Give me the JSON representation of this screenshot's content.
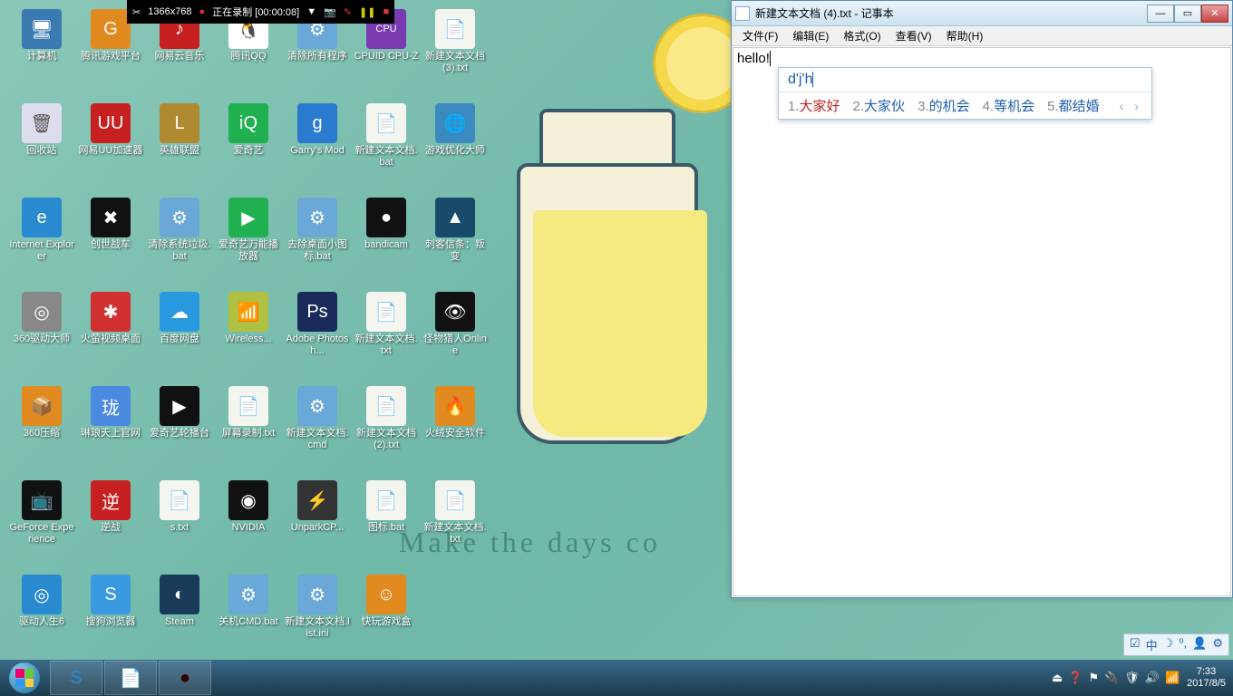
{
  "wallpaper_text": "Make the days co",
  "recording_bar": {
    "crop_icon": "✂",
    "resolution": "1366x768",
    "status": "正在录制 [00:00:08]",
    "dropdown": "▼",
    "cam": "📷",
    "pencil": "✎",
    "pause": "❚❚",
    "stop": "■"
  },
  "desktop_icons": [
    {
      "label": "计算机",
      "bg": "#3a7ab0",
      "glyph": "🖥"
    },
    {
      "label": "腾讯游戏平台",
      "bg": "#e08a20",
      "glyph": "G"
    },
    {
      "label": "网易云音乐",
      "bg": "#c62020",
      "glyph": "♪"
    },
    {
      "label": "腾讯QQ",
      "bg": "#ffffff",
      "glyph": "🐧"
    },
    {
      "label": "清除所有程序",
      "bg": "#6aa8d8",
      "glyph": "⚙"
    },
    {
      "label": "CPUID CPU-Z",
      "bg": "#7a3ab0",
      "glyph": "CPU"
    },
    {
      "label": "新建文本文档 (3).txt",
      "bg": "#f5f5f0",
      "glyph": "📄"
    },
    {
      "label": "回收站",
      "bg": "#dde",
      "glyph": "🗑"
    },
    {
      "label": "网易UU加速器",
      "bg": "#c62020",
      "glyph": "UU"
    },
    {
      "label": "英雄联盟",
      "bg": "#b08a30",
      "glyph": "L"
    },
    {
      "label": "爱奇艺",
      "bg": "#20b050",
      "glyph": "iQ"
    },
    {
      "label": "Garry's Mod",
      "bg": "#2a7ad0",
      "glyph": "g"
    },
    {
      "label": "新建文本文档.bat",
      "bg": "#f5f5f0",
      "glyph": "📄"
    },
    {
      "label": "游戏优化大师",
      "bg": "#3a8ac0",
      "glyph": "🌐"
    },
    {
      "label": "Internet Explorer",
      "bg": "#2a8ad0",
      "glyph": "e"
    },
    {
      "label": "创世战车",
      "bg": "#111",
      "glyph": "✖"
    },
    {
      "label": "清除系统垃圾.bat",
      "bg": "#6aa8d8",
      "glyph": "⚙"
    },
    {
      "label": "爱奇艺万能播放器",
      "bg": "#20b050",
      "glyph": "▶"
    },
    {
      "label": "去除桌面小图标.bat",
      "bg": "#6aa8d8",
      "glyph": "⚙"
    },
    {
      "label": "bandicam",
      "bg": "#111",
      "glyph": "●"
    },
    {
      "label": "刺客信条：叛变",
      "bg": "#1a4a6a",
      "glyph": "▲"
    },
    {
      "label": "360驱动大师",
      "bg": "#888",
      "glyph": "◎"
    },
    {
      "label": "火萤视频桌面",
      "bg": "#d03030",
      "glyph": "✱"
    },
    {
      "label": "百度网盘",
      "bg": "#2a9ae0",
      "glyph": "☁"
    },
    {
      "label": "Wireless...",
      "bg": "#b0c040",
      "glyph": "📶"
    },
    {
      "label": "Adobe Photosh...",
      "bg": "#1a2a5a",
      "glyph": "Ps"
    },
    {
      "label": "新建文本文档.txt",
      "bg": "#f5f5f0",
      "glyph": "📄"
    },
    {
      "label": "怪物猎人Online",
      "bg": "#111",
      "glyph": "👁"
    },
    {
      "label": "360压缩",
      "bg": "#e08a20",
      "glyph": "📦"
    },
    {
      "label": "琳琅天上官网",
      "bg": "#4a8ae0",
      "glyph": "珑"
    },
    {
      "label": "爱奇艺轮播台",
      "bg": "#111",
      "glyph": "▶"
    },
    {
      "label": "屏幕录制.txt",
      "bg": "#f5f5f0",
      "glyph": "📄"
    },
    {
      "label": "新建文本文档.cmd",
      "bg": "#6aa8d8",
      "glyph": "⚙"
    },
    {
      "label": "新建文本文档 (2).txt",
      "bg": "#f5f5f0",
      "glyph": "📄"
    },
    {
      "label": "火绒安全软件",
      "bg": "#e08a20",
      "glyph": "🔥"
    },
    {
      "label": "GeForce Experience",
      "bg": "#111",
      "glyph": "📺"
    },
    {
      "label": "逆战",
      "bg": "#c62020",
      "glyph": "逆"
    },
    {
      "label": "s.txt",
      "bg": "#f5f5f0",
      "glyph": "📄"
    },
    {
      "label": "NVIDIA",
      "bg": "#111",
      "glyph": "◉"
    },
    {
      "label": "UnparkCP...",
      "bg": "#333",
      "glyph": "⚡"
    },
    {
      "label": "图标.bat",
      "bg": "#f5f5f0",
      "glyph": "📄"
    },
    {
      "label": "新建文本文档.txt",
      "bg": "#f5f5f0",
      "glyph": "📄"
    },
    {
      "label": "驱动人生6",
      "bg": "#2a8ad0",
      "glyph": "◎"
    },
    {
      "label": "搜狗浏览器",
      "bg": "#3a9ae0",
      "glyph": "S"
    },
    {
      "label": "Steam",
      "bg": "#1a3a5a",
      "glyph": "◐"
    },
    {
      "label": "关机CMD.bat",
      "bg": "#6aa8d8",
      "glyph": "⚙"
    },
    {
      "label": "新建文本文档.list.ini",
      "bg": "#6aa8d8",
      "glyph": "⚙"
    },
    {
      "label": "快玩游戏盒",
      "bg": "#e08a20",
      "glyph": "☺"
    }
  ],
  "notepad": {
    "title": "新建文本文档 (4).txt - 记事本",
    "menus": [
      "文件(F)",
      "编辑(E)",
      "格式(O)",
      "查看(V)",
      "帮助(H)"
    ],
    "content": "hello!",
    "win_min": "—",
    "win_max": "▭",
    "win_close": "✕"
  },
  "ime": {
    "input": "d'j'h",
    "candidates": [
      {
        "n": "1.",
        "t": "大家好"
      },
      {
        "n": "2.",
        "t": "大家伙"
      },
      {
        "n": "3.",
        "t": "的机会"
      },
      {
        "n": "4.",
        "t": "等机会"
      },
      {
        "n": "5.",
        "t": "都结婚"
      }
    ],
    "nav": "‹ ›"
  },
  "langbar": {
    "items": [
      "☑",
      "中",
      "☽",
      "⁰,",
      "👤",
      "⚙"
    ]
  },
  "taskbar": {
    "items": [
      {
        "glyph": "S",
        "bg": "#fff"
      },
      {
        "glyph": "📄",
        "bg": "#cde"
      },
      {
        "glyph": "●",
        "bg": "#300"
      }
    ],
    "tray_icons": [
      "⏏",
      "❓",
      "⚑",
      "🔌",
      "🛡",
      "🔊",
      "📶"
    ],
    "time": "7:33",
    "date": "2017/8/5"
  }
}
